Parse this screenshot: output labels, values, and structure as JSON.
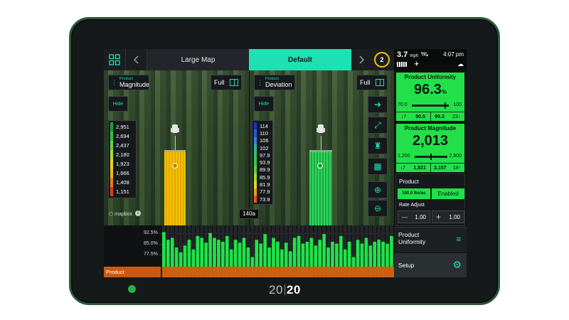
{
  "device": {
    "brand_left": "20",
    "brand_right": "20"
  },
  "topbar": {
    "grid_icon": "grid-icon",
    "tab_large_map": "Large Map",
    "tab_default": "Default",
    "alert_count": "2"
  },
  "status": {
    "speed": "3.7",
    "speed_unit": "mph",
    "time": "4:07 pm"
  },
  "map_left": {
    "layer_small": "Product",
    "layer_big": "Magnitude",
    "full_label": "Full",
    "hide_label": "Hide",
    "legend": [
      "2,951",
      "2,694",
      "2,437",
      "2,180",
      "1,923",
      "1,666",
      "1,408",
      "1,151"
    ],
    "legend_colors": [
      "#1f9e3a",
      "#2bc448",
      "#63d63b",
      "#a8e02f",
      "#e6d61d",
      "#f0b814",
      "#ee7d12",
      "#d9401c"
    ],
    "mapbox": "mapbox"
  },
  "map_right": {
    "layer_small": "Product",
    "layer_big": "Deviation",
    "full_label": "Full",
    "hide_label": "Hide",
    "legend": [
      "114",
      "110",
      "106",
      "102",
      "97.9",
      "93.9",
      "89.9",
      "85.9",
      "81.9",
      "77.9",
      "73.9"
    ],
    "legend_colors": [
      "#1d2fc6",
      "#2957d8",
      "#2e86d0",
      "#2fb2a8",
      "#2cc45a",
      "#2fcf3f",
      "#58d33a",
      "#a0dc33",
      "#e3d420",
      "#f29c14",
      "#e85a16"
    ]
  },
  "row_label": "140a",
  "chart": {
    "y_labels": [
      "92.5%",
      "85.0%",
      "77.5%"
    ],
    "product_label": "Product",
    "bar_values": [
      96,
      88,
      90,
      80,
      75,
      82,
      88,
      78,
      92,
      90,
      85,
      95,
      90,
      88,
      86,
      92,
      78,
      88,
      85,
      90,
      80,
      70,
      88,
      84,
      94,
      80,
      90,
      86,
      78,
      85,
      76,
      90,
      92,
      84,
      86,
      90,
      82,
      88,
      94,
      80,
      86,
      84,
      92,
      78,
      86,
      70,
      88,
      84,
      90,
      82,
      86,
      88,
      86,
      84,
      92
    ]
  },
  "chart_data": {
    "type": "bar",
    "y_ticks": [
      "92.5%",
      "85.0%",
      "77.5%"
    ],
    "values": [
      96,
      88,
      90,
      80,
      75,
      82,
      88,
      78,
      92,
      90,
      85,
      95,
      90,
      88,
      86,
      92,
      78,
      88,
      85,
      90,
      80,
      70,
      88,
      84,
      94,
      80,
      90,
      86,
      78,
      85,
      76,
      90,
      92,
      84,
      86,
      90,
      82,
      88,
      94,
      80,
      86,
      84,
      92,
      78,
      86,
      70,
      88,
      84,
      90,
      82,
      86,
      88,
      86,
      84,
      92
    ]
  },
  "uniformity": {
    "title": "Product Uniformity",
    "value": "96.3",
    "unit": "%",
    "low": "70.0",
    "high": "100",
    "below_count": "7",
    "left_val": "90.5",
    "right_val": "99.3",
    "above_count": "23"
  },
  "magnitude": {
    "title": "Product Magnitude",
    "value": "2,013",
    "low": "1,200",
    "high": "2,800",
    "below_count": "7",
    "left_val": "1,821",
    "right_val": "2,157",
    "above_count": "18"
  },
  "product_panel": {
    "title": "Product",
    "rate": "100.0 lbs/ac",
    "state": "Enabled",
    "rate_adjust_label": "Rate Adjust",
    "adjust_minus_value": "1.00",
    "adjust_plus_value": "1.00"
  },
  "bottom": {
    "uniformity_line1": "Product",
    "uniformity_line2": "Uniformity",
    "setup": "Setup"
  }
}
